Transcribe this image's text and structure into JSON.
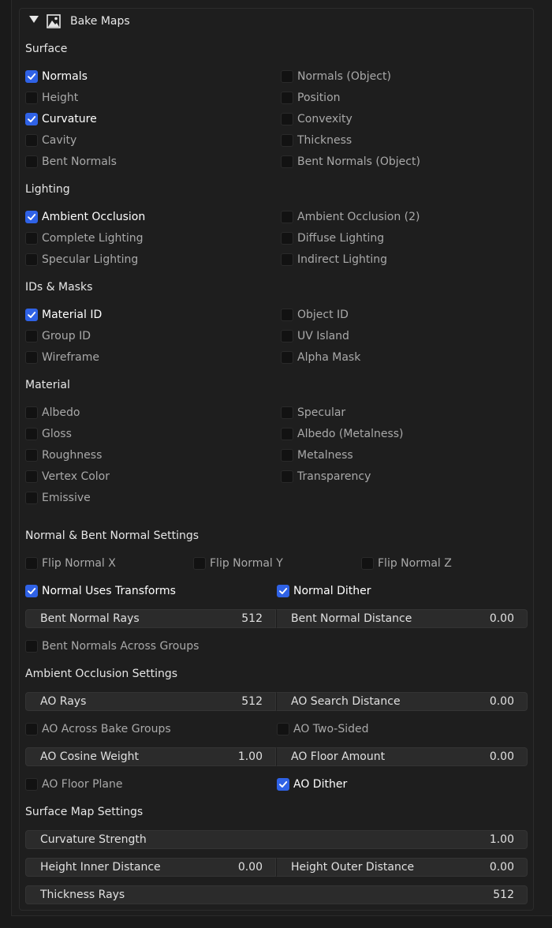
{
  "panel": {
    "title": "Bake Maps",
    "icon": "image-icon",
    "expand_icon": "triangle-down-icon"
  },
  "sections": {
    "surface": "Surface",
    "lighting": "Lighting",
    "ids_masks": "IDs & Masks",
    "material": "Material",
    "normal_settings": "Normal & Bent Normal Settings",
    "ao_settings": "Ambient Occlusion Settings",
    "surface_map_settings": "Surface Map Settings"
  },
  "surface": [
    {
      "label": "Normals",
      "checked": true
    },
    {
      "label": "Normals (Object)",
      "checked": false
    },
    {
      "label": "Height",
      "checked": false
    },
    {
      "label": "Position",
      "checked": false
    },
    {
      "label": "Curvature",
      "checked": true
    },
    {
      "label": "Convexity",
      "checked": false
    },
    {
      "label": "Cavity",
      "checked": false
    },
    {
      "label": "Thickness",
      "checked": false
    },
    {
      "label": "Bent Normals",
      "checked": false
    },
    {
      "label": "Bent Normals (Object)",
      "checked": false
    }
  ],
  "lighting": [
    {
      "label": "Ambient Occlusion",
      "checked": true
    },
    {
      "label": "Ambient Occlusion (2)",
      "checked": false
    },
    {
      "label": "Complete Lighting",
      "checked": false
    },
    {
      "label": "Diffuse Lighting",
      "checked": false
    },
    {
      "label": "Specular Lighting",
      "checked": false
    },
    {
      "label": "Indirect Lighting",
      "checked": false
    }
  ],
  "ids_masks": [
    {
      "label": "Material ID",
      "checked": true
    },
    {
      "label": "Object ID",
      "checked": false
    },
    {
      "label": "Group ID",
      "checked": false
    },
    {
      "label": "UV Island",
      "checked": false
    },
    {
      "label": "Wireframe",
      "checked": false
    },
    {
      "label": "Alpha Mask",
      "checked": false
    }
  ],
  "material": [
    {
      "label": "Albedo",
      "checked": false
    },
    {
      "label": "Specular",
      "checked": false
    },
    {
      "label": "Gloss",
      "checked": false
    },
    {
      "label": "Albedo (Metalness)",
      "checked": false
    },
    {
      "label": "Roughness",
      "checked": false
    },
    {
      "label": "Metalness",
      "checked": false
    },
    {
      "label": "Vertex Color",
      "checked": false
    },
    {
      "label": "Transparency",
      "checked": false
    },
    {
      "label": "Emissive",
      "checked": false
    }
  ],
  "normal_settings": {
    "flip_x": {
      "label": "Flip Normal X",
      "checked": false
    },
    "flip_y": {
      "label": "Flip Normal Y",
      "checked": false
    },
    "flip_z": {
      "label": "Flip Normal Z",
      "checked": false
    },
    "uses_transforms": {
      "label": "Normal Uses Transforms",
      "checked": true
    },
    "dither": {
      "label": "Normal Dither",
      "checked": true
    },
    "bent_rays": {
      "label": "Bent Normal Rays",
      "value": "512"
    },
    "bent_distance": {
      "label": "Bent Normal Distance",
      "value": "0.00"
    },
    "across_groups": {
      "label": "Bent Normals Across Groups",
      "checked": false
    }
  },
  "ao_settings": {
    "rays": {
      "label": "AO Rays",
      "value": "512"
    },
    "search_distance": {
      "label": "AO Search Distance",
      "value": "0.00"
    },
    "across_groups": {
      "label": "AO Across Bake Groups",
      "checked": false
    },
    "two_sided": {
      "label": "AO Two-Sided",
      "checked": false
    },
    "cosine_weight": {
      "label": "AO Cosine Weight",
      "value": "1.00"
    },
    "floor_amount": {
      "label": "AO Floor Amount",
      "value": "0.00"
    },
    "floor_plane": {
      "label": "AO Floor Plane",
      "checked": false
    },
    "dither": {
      "label": "AO Dither",
      "checked": true
    }
  },
  "surface_map_settings": {
    "curvature_strength": {
      "label": "Curvature Strength",
      "value": "1.00"
    },
    "height_inner": {
      "label": "Height Inner Distance",
      "value": "0.00"
    },
    "height_outer": {
      "label": "Height Outer Distance",
      "value": "0.00"
    },
    "thickness_rays": {
      "label": "Thickness Rays",
      "value": "512"
    }
  },
  "colors": {
    "accent": "#2f62e6",
    "panel_bg": "#1e1e1e",
    "field_bg": "#2b2b2b",
    "checkbox_bg": "#121212"
  }
}
